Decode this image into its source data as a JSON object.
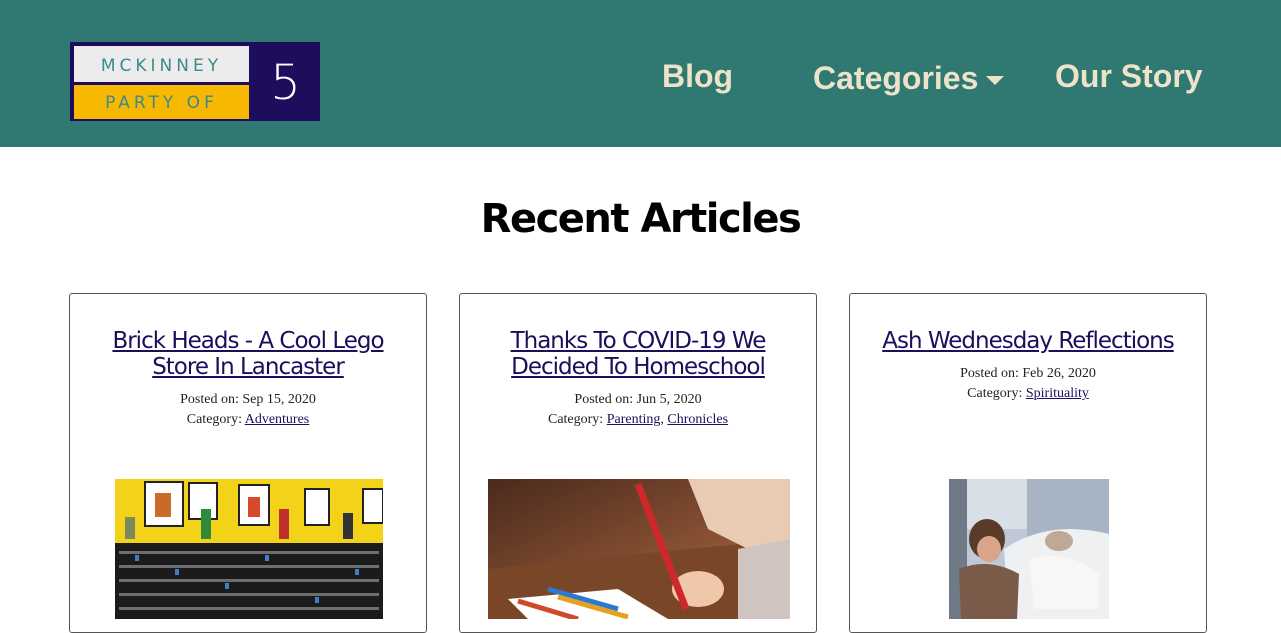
{
  "header": {
    "logo": {
      "line1": "MCKINNEY",
      "line2": "PARTY OF",
      "number": "5"
    },
    "nav": {
      "blog": "Blog",
      "categories": "Categories",
      "our_story": "Our Story"
    },
    "colors": {
      "background": "#307872",
      "nav_text": "#ece3c8",
      "logo_navy": "#1e0d5c",
      "logo_yellow": "#f6b800"
    }
  },
  "main": {
    "title": "Recent Articles",
    "articles": [
      {
        "title": "Brick Heads - A Cool Lego Store In Lancaster",
        "posted_label": "Posted on:",
        "date": "Sep 15, 2020",
        "category_label": "Category:",
        "categories": [
          "Adventures"
        ]
      },
      {
        "title": "Thanks To COVID-19 We Decided To Homeschool",
        "posted_label": "Posted on:",
        "date": "Jun 5, 2020",
        "category_label": "Category:",
        "categories": [
          "Parenting",
          "Chronicles"
        ]
      },
      {
        "title": "Ash Wednesday Reflections",
        "posted_label": "Posted on:",
        "date": "Feb 26, 2020",
        "category_label": "Category:",
        "categories": [
          "Spirituality"
        ]
      }
    ]
  }
}
